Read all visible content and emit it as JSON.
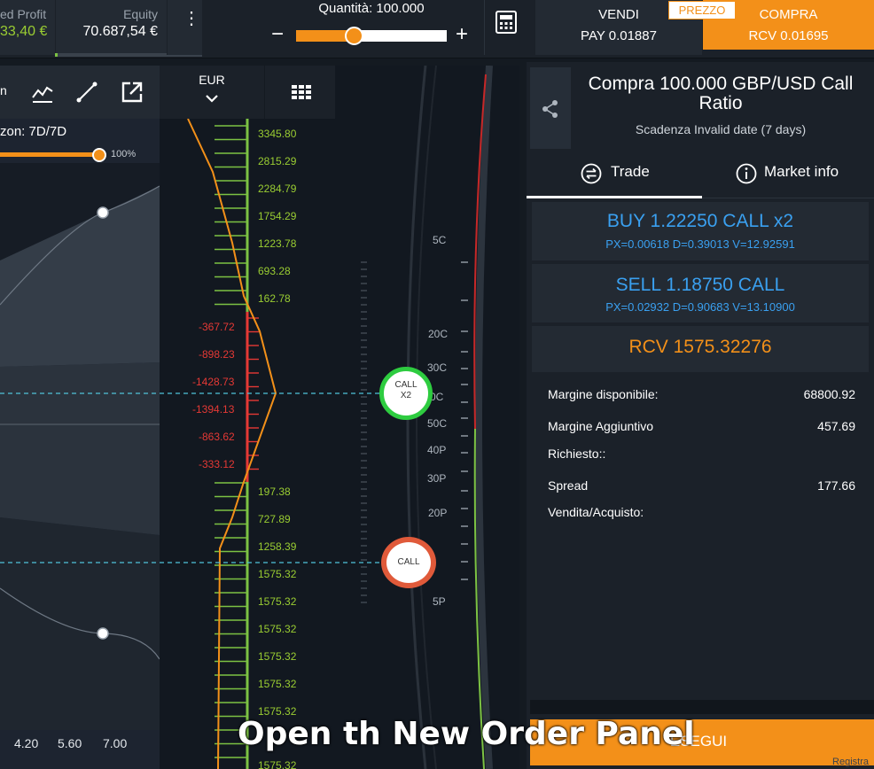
{
  "topbar": {
    "profit_label": "ed Profit",
    "profit_value": "33,40 €",
    "equity_label": "Equity",
    "equity_value": "70.687,54 €",
    "equity_fill": 0.02,
    "menu_icon": "more-vertical-icon",
    "quantity_label": "Quantità: 100.000",
    "quantity_slider_pct": 0.38,
    "minus": "−",
    "plus": "+",
    "calculator_icon": "calculator-icon",
    "sell_label": "VENDI",
    "sell_price": "PAY 0.01887",
    "buy_label": "COMPRA",
    "buy_price": "RCV 0.01695",
    "price_tag": "PREZZO"
  },
  "left_chart": {
    "tools": [
      "chart-line-icon",
      "trendline-icon",
      "external-link-icon"
    ],
    "tool_prefix": "n",
    "horizon_label": "zon: 7D/7D",
    "horizon_pct": "100%",
    "x_ticks": [
      "4.20",
      "5.60",
      "7.00"
    ]
  },
  "ladder": {
    "currency": "EUR",
    "levels_pos_top": [
      "3345.80",
      "2815.29",
      "2284.79",
      "1754.29",
      "1223.78",
      "693.28",
      "162.78"
    ],
    "levels_neg": [
      "-367.72",
      "-898.23",
      "-1428.73",
      "-1394.13",
      "-863.62",
      "-333.12"
    ],
    "levels_pos_bottom": [
      "197.38",
      "727.89",
      "1258.39",
      "1575.32",
      "1575.32",
      "1575.32",
      "1575.32",
      "1575.32",
      "1575.32",
      "1575.32"
    ],
    "strikes": [
      "5C",
      "20C",
      "30C",
      "0C",
      "50C",
      "40P",
      "30P",
      "20P",
      "5P"
    ],
    "call_x2_line1": "CALL",
    "call_x2_line2": "X2",
    "call_single": "CALL"
  },
  "panel": {
    "title": "Compra 100.000 GBP/USD Call Ratio",
    "subtitle": "Scadenza Invalid date (7 days)",
    "tab_trade": "Trade",
    "tab_info": "Market info",
    "leg1_main": "BUY 1.22250 CALL x2",
    "leg1_sub": "PX=0.00618 D=0.39013 V=12.92591",
    "leg2_main": "SELL 1.18750 CALL",
    "leg2_sub": "PX=0.02932 D=0.90683 V=13.10900",
    "rcv": "RCV 1575.32276",
    "margin_available_label": "Margine disponibile:",
    "margin_available_value": "68800.92",
    "margin_additional_label_1": "Margine Aggiuntivo",
    "margin_additional_label_2": "Richiesto::",
    "margin_additional_value": "457.69",
    "spread_label_1": "Spread",
    "spread_label_2": "Vendita/Acquisto:",
    "spread_value": "177.66",
    "execute": "ESEGUI",
    "watermark": "Registra"
  },
  "caption": "Open th New Order Panel"
}
